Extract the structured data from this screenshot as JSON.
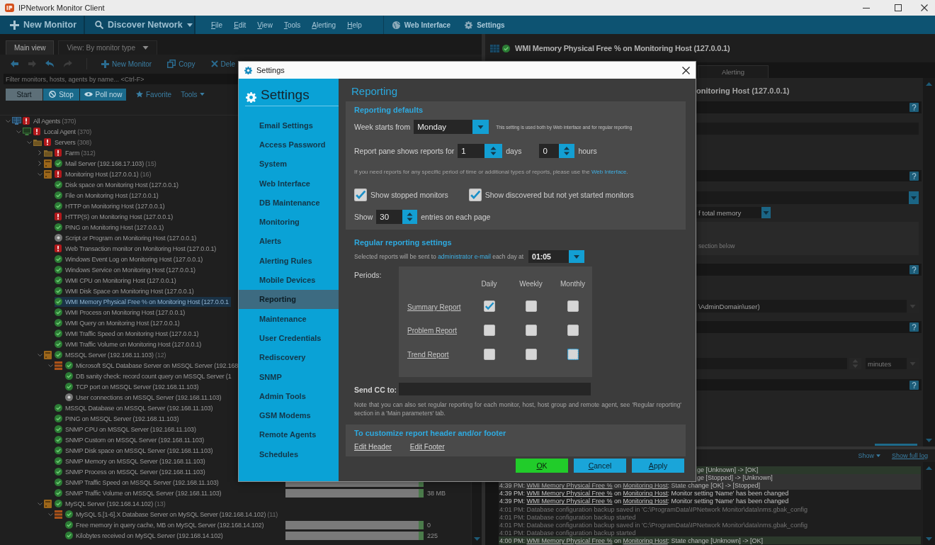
{
  "window": {
    "title": "IPNetwork Monitor Client"
  },
  "toolbar": {
    "new_monitor": "New Monitor",
    "discover": "Discover Network",
    "menus": [
      "File",
      "Edit",
      "View",
      "Tools",
      "Alerting",
      "Help"
    ],
    "links": [
      {
        "label": "Web Interface",
        "kind": "web"
      },
      {
        "label": "Settings",
        "kind": "settings"
      }
    ]
  },
  "left_panel": {
    "tabs": [
      {
        "label": "Main view",
        "selected": true,
        "kind": "tab"
      },
      {
        "label": "View: By monitor type",
        "selected": false,
        "kind": "dropdown"
      }
    ],
    "nav_buttons": [
      {
        "kind": "back",
        "disabled": false
      },
      {
        "kind": "forward",
        "disabled": true
      },
      {
        "kind": "undo",
        "disabled": false
      },
      {
        "kind": "redo",
        "disabled": true
      }
    ],
    "actions": [
      {
        "label": "New Monitor",
        "kind": "new"
      },
      {
        "label": "Copy",
        "kind": "copy"
      },
      {
        "label": "Dele",
        "kind": "delete"
      }
    ],
    "filter": {
      "placeholder": "Filter monitors, hosts, agents by name... <Ctrl-F>"
    },
    "controls": [
      {
        "label": "Start",
        "kind": "start"
      },
      {
        "label": "Stop",
        "kind": "stop"
      },
      {
        "label": "Poll now",
        "kind": "poll"
      },
      {
        "label": "Favorite",
        "kind": "favorite"
      },
      {
        "label": "Tools",
        "kind": "menu"
      }
    ],
    "tree": [
      {
        "label": "All Agents",
        "count": "(370)",
        "kind": "agents",
        "alarm": true,
        "paused": false,
        "expanded": true,
        "selected": false,
        "children": [
          {
            "label": "Local Agent",
            "count": "(370)",
            "kind": "agent",
            "alarm": true,
            "paused": false,
            "expanded": true,
            "selected": false,
            "children": [
              {
                "label": "Servers",
                "count": "(308)",
                "kind": "folder",
                "alarm": true,
                "paused": false,
                "expanded": true,
                "selected": false,
                "children": [
                  {
                    "label": "Farm",
                    "count": "(312)",
                    "kind": "folder",
                    "alarm": true,
                    "paused": false,
                    "expanded": false,
                    "selected": false
                  },
                  {
                    "label": "Mail Server (192.168.17.103)",
                    "count": "(15)",
                    "kind": "host",
                    "alarm": false,
                    "paused": false,
                    "expanded": false,
                    "selected": false
                  },
                  {
                    "label": "Monitoring Host (127.0.0.1)",
                    "count": "(16)",
                    "kind": "host",
                    "alarm": true,
                    "paused": false,
                    "expanded": true,
                    "selected": false,
                    "children": [
                      {
                        "label": "Disk space on Monitoring Host (127.0.0.1)",
                        "kind": "monitor",
                        "alarm": false,
                        "paused": false,
                        "selected": false
                      },
                      {
                        "label": "File on Monitoring Host (127.0.0.1)",
                        "kind": "monitor",
                        "alarm": false,
                        "paused": false,
                        "selected": false
                      },
                      {
                        "label": "HTTP on Monitoring Host (127.0.0.1)",
                        "kind": "monitor",
                        "alarm": false,
                        "paused": false,
                        "selected": false
                      },
                      {
                        "label": "HTTP(S) on Monitoring Host (127.0.0.1)",
                        "kind": "monitor",
                        "alarm": true,
                        "paused": false,
                        "selected": false
                      },
                      {
                        "label": "PING on Monitoring Host (127.0.0.1)",
                        "kind": "monitor",
                        "alarm": false,
                        "paused": false,
                        "selected": false
                      },
                      {
                        "label": "Script or Program on Monitoring Host (127.0.0.1)",
                        "kind": "monitor",
                        "alarm": false,
                        "paused": true,
                        "selected": false
                      },
                      {
                        "label": "Web Transaction monitor on Monitoring Host (127.0.0.1)",
                        "kind": "monitor",
                        "alarm": true,
                        "paused": false,
                        "selected": false
                      },
                      {
                        "label": "Windows Event Log on Monitoring Host (127.0.0.1)",
                        "kind": "monitor",
                        "alarm": false,
                        "paused": false,
                        "selected": false
                      },
                      {
                        "label": "Windows Service on Monitoring Host (127.0.0.1)",
                        "kind": "monitor",
                        "alarm": false,
                        "paused": false,
                        "selected": false
                      },
                      {
                        "label": "WMI CPU on Monitoring Host (127.0.0.1)",
                        "kind": "monitor",
                        "alarm": false,
                        "paused": false,
                        "selected": false
                      },
                      {
                        "label": "WMI Disk Space on Monitoring Host (127.0.0.1)",
                        "kind": "monitor",
                        "alarm": false,
                        "paused": false,
                        "selected": false
                      },
                      {
                        "label": "WMI Memory Physical Free % on Monitoring Host (127.0.0.1",
                        "kind": "monitor",
                        "alarm": false,
                        "paused": false,
                        "selected": true
                      },
                      {
                        "label": "WMI Process on Monitoring Host (127.0.0.1)",
                        "kind": "monitor",
                        "alarm": false,
                        "paused": false,
                        "selected": false
                      },
                      {
                        "label": "WMI Query on Monitoring Host (127.0.0.1)",
                        "kind": "monitor",
                        "alarm": false,
                        "paused": false,
                        "selected": false
                      },
                      {
                        "label": "WMI Traffic Speed on Monitoring Host (127.0.0.1)",
                        "kind": "monitor",
                        "alarm": false,
                        "paused": false,
                        "selected": false
                      },
                      {
                        "label": "WMI Traffic Volume on Monitoring Host (127.0.0.1)",
                        "kind": "monitor",
                        "alarm": false,
                        "paused": false,
                        "selected": false
                      }
                    ]
                  },
                  {
                    "label": "MSSQL Server (192.168.11.103)",
                    "count": "(12)",
                    "kind": "host",
                    "alarm": false,
                    "paused": false,
                    "expanded": true,
                    "selected": false,
                    "children": [
                      {
                        "label": "Microsoft SQL Database Server on MSSQL Server (192.168",
                        "kind": "database",
                        "alarm": false,
                        "paused": false,
                        "expanded": true,
                        "selected": false,
                        "children": [
                          {
                            "label": "DB sanity check: record count query on MSSQL Server (1",
                            "kind": "monitor",
                            "alarm": false,
                            "paused": false,
                            "selected": false
                          },
                          {
                            "label": "TCP port on MSSQL Server (192.168.11.103)",
                            "kind": "monitor",
                            "alarm": false,
                            "paused": false,
                            "selected": false
                          },
                          {
                            "label": "User connections on MSSQL Server (192.168.11.103)",
                            "kind": "monitor",
                            "alarm": false,
                            "paused": true,
                            "selected": false
                          }
                        ]
                      },
                      {
                        "label": "MSSQL Database on MSSQL Server (192.168.11.103)",
                        "kind": "monitor",
                        "alarm": false,
                        "paused": false,
                        "selected": false
                      },
                      {
                        "label": "PING on MSSQL Server (192.168.11.103)",
                        "kind": "monitor",
                        "alarm": false,
                        "paused": false,
                        "selected": false
                      },
                      {
                        "label": "SNMP CPU on MSSQL Server (192.168.11.103)",
                        "kind": "monitor",
                        "alarm": false,
                        "paused": false,
                        "selected": false
                      },
                      {
                        "label": "SNMP Custom on MSSQL Server (192.168.11.103)",
                        "kind": "monitor",
                        "alarm": false,
                        "paused": false,
                        "selected": false
                      },
                      {
                        "label": "SNMP Disk space on MSSQL Server (192.168.11.103)",
                        "kind": "monitor",
                        "alarm": false,
                        "paused": false,
                        "selected": false
                      },
                      {
                        "label": "SNMP Memory on MSSQL Server (192.168.11.103)",
                        "kind": "monitor",
                        "alarm": false,
                        "paused": false,
                        "selected": false
                      },
                      {
                        "label": "SNMP Process on MSSQL Server (192.168.11.103)",
                        "kind": "monitor",
                        "alarm": false,
                        "paused": false,
                        "selected": false
                      },
                      {
                        "label": "SNMP Traffic Speed on MSSQL Server (192.168.11.103)",
                        "kind": "monitor",
                        "alarm": false,
                        "paused": false,
                        "selected": false,
                        "bar": true
                      },
                      {
                        "label": "SNMP Traffic Volume on MSSQL Server (192.168.11.103)",
                        "kind": "monitor",
                        "alarm": false,
                        "paused": false,
                        "selected": false,
                        "bar": true,
                        "value": "38 MB"
                      }
                    ]
                  },
                  {
                    "label": "MySQL Server (192.168.14.102)",
                    "count": "(13)",
                    "kind": "host",
                    "alarm": false,
                    "paused": false,
                    "expanded": true,
                    "selected": false,
                    "children": [
                      {
                        "label": "MySQL 5.[1-6].X Database Server on MySQL Server (192.168.14.102)",
                        "count": "(11)",
                        "kind": "database",
                        "alarm": false,
                        "paused": false,
                        "expanded": true,
                        "selected": false,
                        "children": [
                          {
                            "label": "Free memory in query cache, MB on MySQL Server (192.168.14.102)",
                            "kind": "monitor",
                            "alarm": false,
                            "paused": false,
                            "selected": false,
                            "bar": true,
                            "value": "0"
                          },
                          {
                            "label": "Kilobytes received on MySQL Server (192.168.14.102)",
                            "kind": "monitor",
                            "alarm": false,
                            "paused": false,
                            "selected": false,
                            "bar": true,
                            "value": "225"
                          }
                        ]
                      }
                    ]
                  }
                ]
              }
            ]
          }
        ]
      }
    ]
  },
  "monitor_panel": {
    "title": "WMI Memory Physical Free % on Monitoring Host (127.0.0.1)",
    "alarm": false,
    "tabs": [
      {
        "label": "Alerting",
        "selected": false
      }
    ],
    "heading": "onitoring Host (127.0.0.1)",
    "memory_unit": "f total memory",
    "note": "section below",
    "account": "\\AdminDomain\\user)",
    "interval_unit": "minutes"
  },
  "log": {
    "filter_menu": "Show",
    "full_log": "Show full log",
    "entries": [
      {
        "kind": "ok",
        "partial": true,
        "parts": [
          {
            "text": "ge [Unknown] -> [OK]"
          }
        ]
      },
      {
        "kind": "changed",
        "partial": true,
        "parts": [
          {
            "text": "ge [Stopped] -> [Unknown]"
          }
        ]
      },
      {
        "kind": "changed",
        "parts": [
          {
            "text": "4:39 PM: "
          },
          {
            "text": "WMI Memory Physical Free %",
            "link": true
          },
          {
            "text": " on "
          },
          {
            "text": "Monitoring Host",
            "link": true
          },
          {
            "text": ": State change [OK] -> [Stopped]"
          }
        ]
      },
      {
        "kind": "info",
        "parts": [
          {
            "text": "4:39 PM: "
          },
          {
            "text": "WMI Memory Physical Free %",
            "link": true
          },
          {
            "text": " on "
          },
          {
            "text": "Monitoring Host",
            "link": true
          },
          {
            "text": ": Monitor setting 'Name' has been changed"
          }
        ]
      },
      {
        "kind": "info",
        "parts": [
          {
            "text": "4:39 PM: "
          },
          {
            "text": "WMI Memory Physical Free %",
            "link": true
          },
          {
            "text": " on "
          },
          {
            "text": "Monitoring Host",
            "link": true
          },
          {
            "text": ": Monitor setting 'Name' has been changed"
          }
        ]
      },
      {
        "kind": "system",
        "parts": [
          {
            "text": "4:01 PM: Database configuration backup saved in 'C:\\ProgramData\\IPNetwork Monitor\\data\\nms.gbak_config"
          }
        ]
      },
      {
        "kind": "system",
        "parts": [
          {
            "text": "4:01 PM: Database configuration backup started"
          }
        ]
      },
      {
        "kind": "system",
        "parts": [
          {
            "text": "4:01 PM: Database configuration backup saved in 'C:\\ProgramData\\IPNetwork Monitor\\data\\nms.gbak_config"
          }
        ]
      },
      {
        "kind": "system",
        "parts": [
          {
            "text": "4:01 PM: Database configuration backup started"
          }
        ]
      },
      {
        "kind": "ok",
        "parts": [
          {
            "text": "4:00 PM: "
          },
          {
            "text": "WMI Memory Physical Free %",
            "link": true
          },
          {
            "text": " on "
          },
          {
            "text": "Monitoring Host",
            "link": true
          },
          {
            "text": ": State change [Unknown] -> [OK]"
          }
        ]
      }
    ]
  },
  "dialog": {
    "title": "Settings",
    "nav_title": "Settings",
    "nav": [
      {
        "label": "Email Settings",
        "selected": false
      },
      {
        "label": "Access Password",
        "selected": false
      },
      {
        "label": "System",
        "selected": false
      },
      {
        "label": "Web Interface",
        "selected": false
      },
      {
        "label": "DB Maintenance",
        "selected": false
      },
      {
        "label": "Monitoring",
        "selected": false
      },
      {
        "label": "Alerts",
        "selected": false
      },
      {
        "label": "Alerting Rules",
        "selected": false
      },
      {
        "label": "Mobile Devices",
        "selected": false
      },
      {
        "label": "Reporting",
        "selected": true
      },
      {
        "label": "Maintenance",
        "selected": false
      },
      {
        "label": "User Credentials",
        "selected": false
      },
      {
        "label": "Rediscovery",
        "selected": false
      },
      {
        "label": "SNMP",
        "selected": false
      },
      {
        "label": "Admin Tools",
        "selected": false
      },
      {
        "label": "GSM Modems",
        "selected": false
      },
      {
        "label": "Remote Agents",
        "selected": false
      },
      {
        "label": "Schedules",
        "selected": false
      }
    ],
    "page_title": "Reporting",
    "defaults": {
      "title": "Reporting defaults",
      "week_label": "Week starts from",
      "week_value": "Monday",
      "week_hint": "This setting is used both by Web interface and for regular reporting",
      "pane_label": "Report pane shows reports for",
      "days_value": "1",
      "days_label": "days",
      "hours_value": "0",
      "hours_label": "hours",
      "info": "If you need reports for any specific period of time or additional types of reports, please use the",
      "info_link": "Web Interface",
      "info_end": ".",
      "checkboxes": [
        {
          "label": "Show stopped monitors",
          "checked": true
        },
        {
          "label": "Show discovered but not yet started monitors",
          "checked": true
        }
      ],
      "show_label": "Show",
      "show_value": "30",
      "show_suffix": "entries on each page"
    },
    "regular": {
      "title": "Regular reporting settings",
      "sent_text": "Selected reports will be sent to",
      "sent_link": "administrator e-mail",
      "sent_suffix": "each day at",
      "time_value": "01:05",
      "periods_label": "Periods:",
      "columns": [
        "Daily",
        "Weekly",
        "Monthly"
      ],
      "reports": [
        {
          "name": "Summary Report",
          "periods": [
            {
              "checked": true,
              "focused": false
            },
            {
              "checked": false,
              "focused": false
            },
            {
              "checked": false,
              "focused": false
            }
          ]
        },
        {
          "name": "Problem Report",
          "periods": [
            {
              "checked": false,
              "focused": false
            },
            {
              "checked": false,
              "focused": false
            },
            {
              "checked": false,
              "focused": false
            }
          ]
        },
        {
          "name": "Trend Report",
          "periods": [
            {
              "checked": false,
              "focused": false
            },
            {
              "checked": false,
              "focused": false
            },
            {
              "checked": false,
              "focused": true
            }
          ]
        }
      ],
      "cc_label": "Send CC to:",
      "note": "Note that you can also set regular reporting for each monitor, host, host group and remote agent, see 'Regular reporting' section in a 'Main parameters' tab."
    },
    "customize": {
      "title": "To customize report header and/or footer",
      "links": [
        "Edit Header",
        "Edit Footer"
      ]
    },
    "buttons": [
      {
        "label": "OK",
        "kind": "primary"
      },
      {
        "label": "Cancel",
        "kind": "secondary"
      },
      {
        "label": "Apply",
        "kind": "secondary"
      }
    ]
  }
}
